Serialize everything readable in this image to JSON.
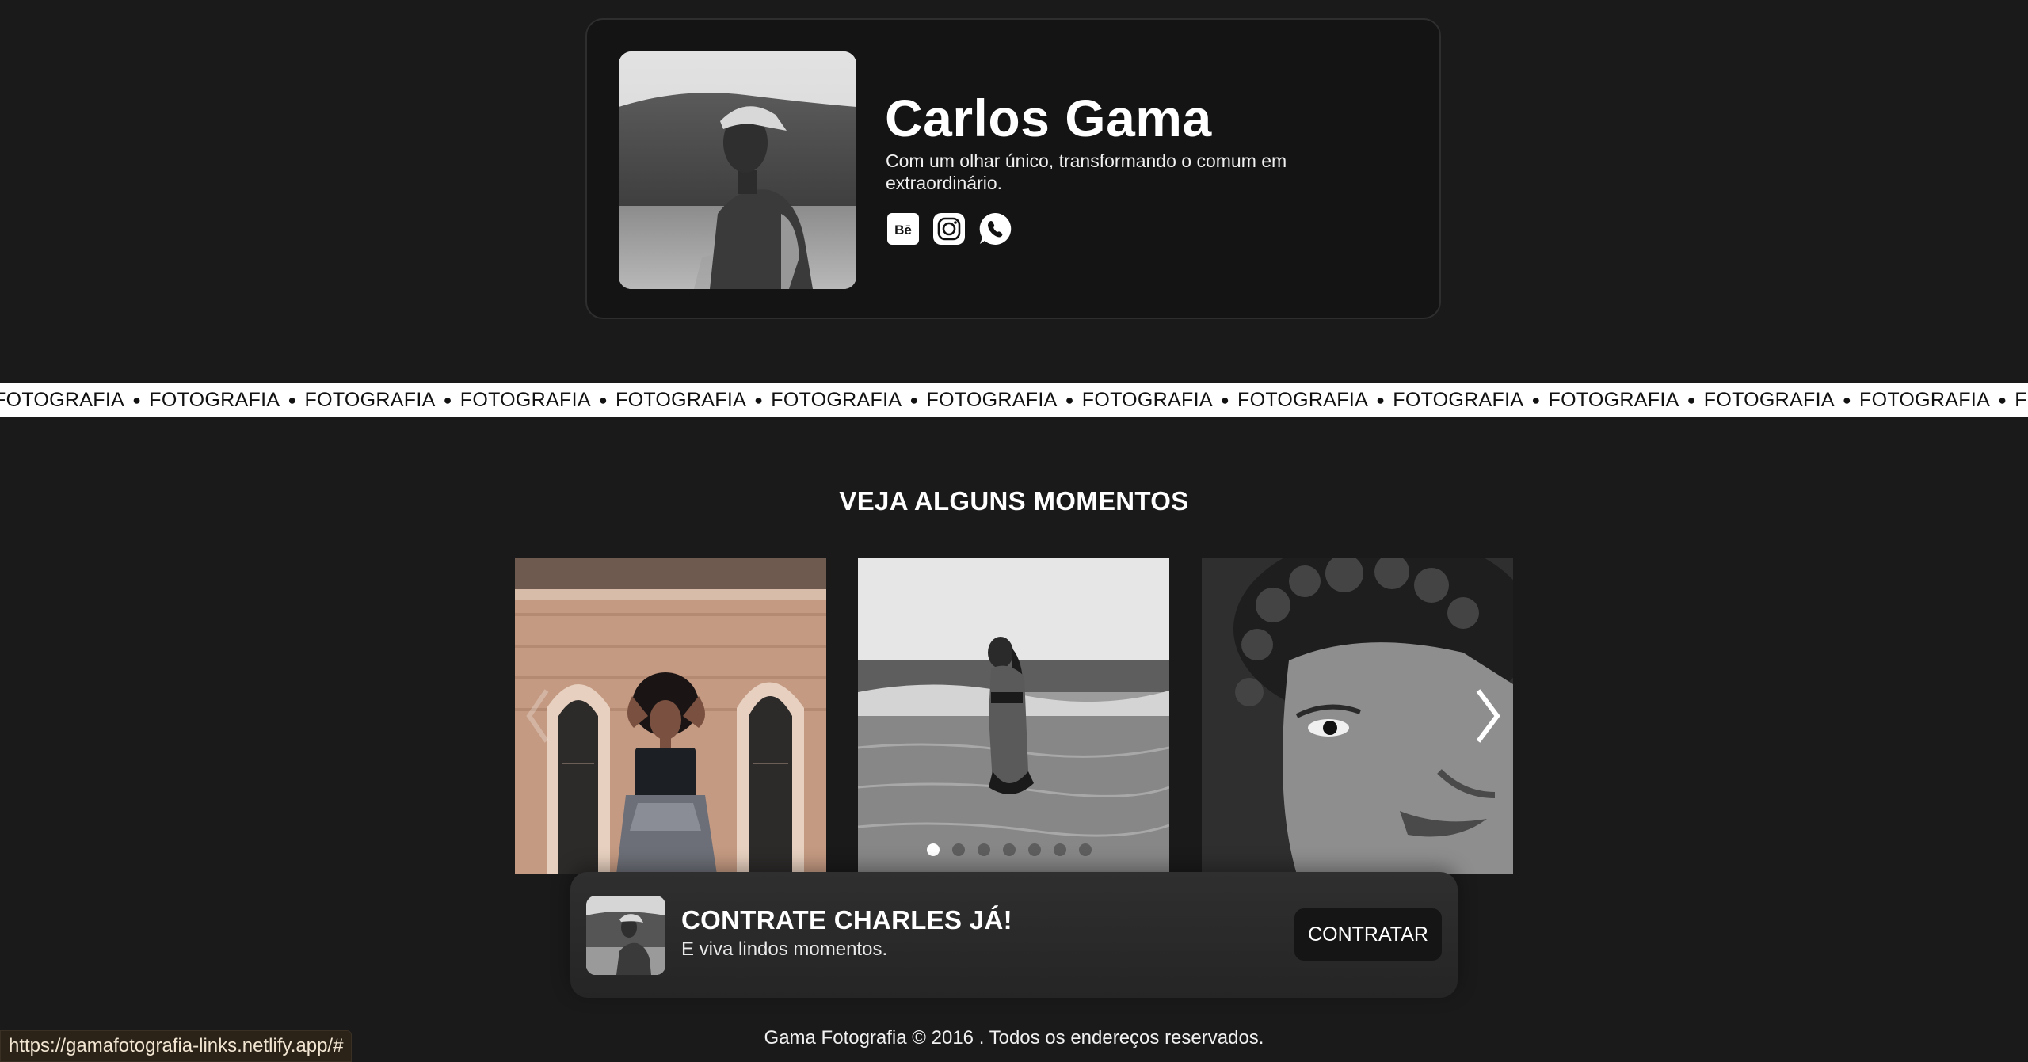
{
  "profile": {
    "name": "Carlos Gama",
    "bio": "Com um olhar único, transformando o comum em extraordinário.",
    "social": [
      {
        "icon": "behance-icon",
        "label": "Bē"
      },
      {
        "icon": "instagram-icon"
      },
      {
        "icon": "whatsapp-icon"
      }
    ]
  },
  "marquee": {
    "word": "FOTOGRAFIA",
    "separator": "●",
    "repeat": 15
  },
  "gallery": {
    "title": "VEJA ALGUNS MOMENTOS",
    "slide_count": 3,
    "dots": 7,
    "active_dot": 0
  },
  "cta": {
    "title": "CONTRATE CHARLES JÁ!",
    "subtitle": "E viva lindos momentos.",
    "button_label": "CONTRATAR"
  },
  "footer": {
    "text": "Gama Fotografia © 2016 . Todos os endereços reservados."
  },
  "status_bar": {
    "url": "https://gamafotografia-links.netlify.app/#"
  },
  "colors": {
    "background": "#1a1a1a",
    "card": "#141414",
    "marquee_bg": "#ffffff",
    "accent": "#ffffff"
  }
}
